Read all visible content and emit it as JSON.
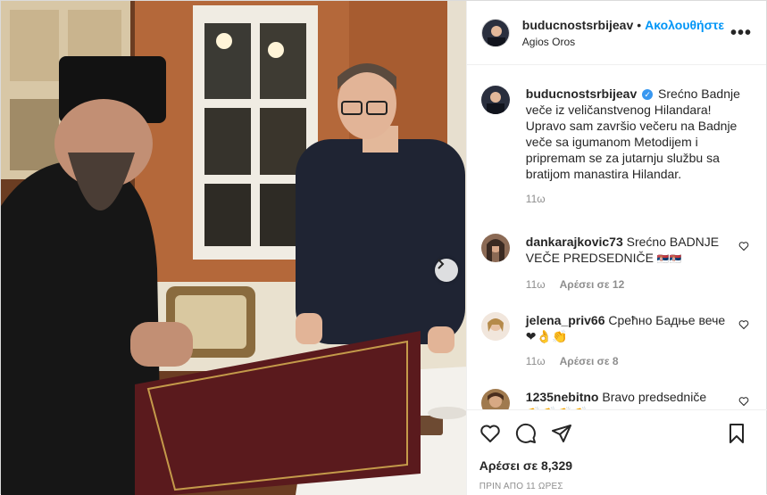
{
  "header": {
    "username": "buducnostsrbijeav",
    "separator": "•",
    "follow_label": "Ακολουθήστε",
    "location": "Agios Oros",
    "more_label": "•••"
  },
  "caption": {
    "username": "buducnostsrbijeav",
    "verified_icon": "✓",
    "text": "Srećno Badnje veče iz veličanstvenog Hilandara! Upravo sam završio večeru na Badnje veče sa igumanom Metodijem i pripremam se za jutarnju službu sa bratijom manastira Hilandar.",
    "time": "11ω"
  },
  "comments": [
    {
      "username": "dankarajkovic73",
      "text": "Srećno BADNJE VEČE PREDSEDNIČE",
      "emoji": "🇷🇸🇷🇸",
      "time": "11ω",
      "likes": "Αρέσει σε 12"
    },
    {
      "username": "jelena_priv66",
      "text": "Срећно Бадње вече",
      "emoji": "❤👌👏",
      "time": "11ω",
      "likes": "Αρέσει σε 8"
    },
    {
      "username": "1235nebitno",
      "text": "Bravo predsedniče",
      "emoji": "👏👏👏👏❤❤❤❤",
      "time": "",
      "likes": ""
    }
  ],
  "actions": {
    "icons": [
      "heart-icon",
      "comment-icon",
      "share-icon",
      "save-icon"
    ],
    "likes_total": "Αρέσει σε 8,329",
    "time_ago": "ΠΡΙΝ ΑΠΟ 11 ΩΡΕΣ"
  },
  "media": {
    "next_icon": "chevron-right-icon"
  },
  "colors": {
    "accent": "#0095f6",
    "verified": "#3897f0",
    "muted": "#8e8e8e"
  }
}
